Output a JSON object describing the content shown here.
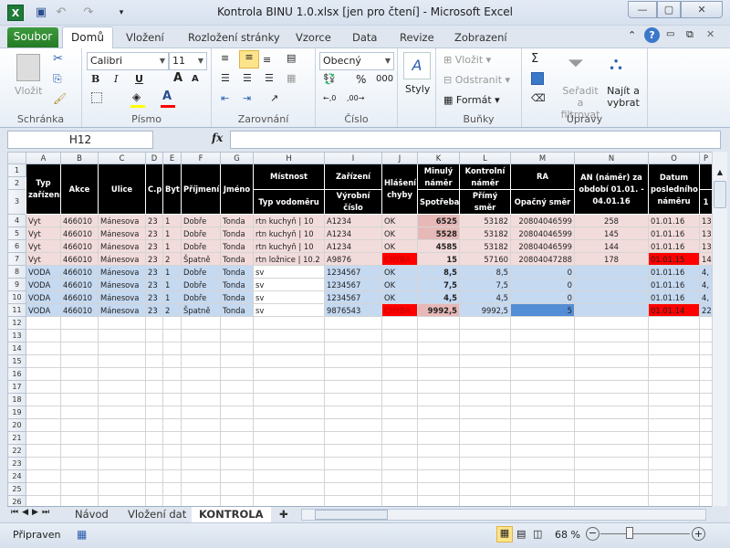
{
  "window": {
    "title": "Kontrola BINU 1.0.xlsx  [jen pro čtení]  -  Microsoft Excel"
  },
  "ribbon_tabs": {
    "file": "Soubor",
    "items": [
      "Domů",
      "Vložení",
      "Rozložení stránky",
      "Vzorce",
      "Data",
      "Revize",
      "Zobrazení"
    ]
  },
  "ribbon": {
    "clipboard": {
      "label": "Schránka",
      "paste": "Vložit"
    },
    "font": {
      "label": "Písmo",
      "name": "Calibri",
      "size": "11",
      "bold": "B",
      "italic": "I",
      "underline": "U",
      "fill_color": "#ffff00",
      "font_color": "#ff0000"
    },
    "alignment": {
      "label": "Zarovnání"
    },
    "number": {
      "label": "Číslo",
      "format": "Obecný",
      "percent": "%",
      "thousands": "000"
    },
    "styles": {
      "label": "Styly"
    },
    "cells": {
      "label": "Buňky",
      "insert": "Vložit",
      "delete": "Odstranit",
      "format": "Formát"
    },
    "editing": {
      "label": "Úpravy",
      "sort": "Seřadit a filtrovat",
      "find": "Najít a vybrat",
      "sum": "Σ"
    }
  },
  "formula_bar": {
    "name_box": "H12",
    "fx": "fx",
    "value": ""
  },
  "columns": [
    "A",
    "B",
    "C",
    "D",
    "E",
    "F",
    "G",
    "H",
    "I",
    "J",
    "K",
    "L",
    "M",
    "N",
    "O",
    "P"
  ],
  "headers": {
    "A": "Typ zařízení",
    "B": "Akce",
    "C": "Ulice",
    "D": "C.p",
    "E": "Byt",
    "F": "Příjmení",
    "G": "Jméno",
    "H_top": "Místnost",
    "H_sub": "Typ vodoměru",
    "I_top": "Zařízení",
    "I_sub": "Výrobní číslo",
    "J": "Hlášení chyby",
    "K_top": "Minulý náměr",
    "K_sub": "Spotřeba",
    "L_top": "Kontrolní náměr",
    "L_sub": "Přímý směr",
    "M_top": "RA",
    "M_sub": "Opačný směr",
    "N": "AN (náměr) za období 01.01. - 04.01.16",
    "O": "Datum posledního náměru",
    "P_sub": "1"
  },
  "rows": [
    {
      "n": 4,
      "type": "pink",
      "cells": [
        "Vyt",
        "466010",
        "Mánesova",
        "23",
        "1",
        "Dobře",
        "Tonda",
        "rtn kuchyň | 10",
        "A1234",
        "OK",
        "6525",
        "53182",
        "20804046599",
        "258",
        "01.01.16",
        "13"
      ]
    },
    {
      "n": 5,
      "type": "pink",
      "cells": [
        "Vyt",
        "466010",
        "Mánesova",
        "23",
        "1",
        "Dobře",
        "Tonda",
        "rtn kuchyň | 10",
        "A1234",
        "OK",
        "5528",
        "53182",
        "20804046599",
        "145",
        "01.01.16",
        "13"
      ]
    },
    {
      "n": 6,
      "type": "pink",
      "cells": [
        "Vyt",
        "466010",
        "Mánesova",
        "23",
        "1",
        "Dobře",
        "Tonda",
        "rtn kuchyň | 10",
        "A1234",
        "OK",
        "4585",
        "53182",
        "20804046599",
        "144",
        "01.01.16",
        "13"
      ]
    },
    {
      "n": 7,
      "type": "pink",
      "cells": [
        "Vyt",
        "466010",
        "Mánesova",
        "23",
        "2",
        "Špatně",
        "Tonda",
        "rtn ložnice | 10.2",
        "A9876",
        "CHYBA",
        "15",
        "57160",
        "20804047288",
        "178",
        "01.01.15",
        "14"
      ]
    },
    {
      "n": 8,
      "type": "blue",
      "cells": [
        "VODA",
        "466010",
        "Mánesova",
        "23",
        "1",
        "Dobře",
        "Tonda",
        "sv",
        "1234567",
        "OK",
        "8,5",
        "8,5",
        "0",
        "",
        "01.01.16",
        "4,"
      ]
    },
    {
      "n": 9,
      "type": "blue",
      "cells": [
        "VODA",
        "466010",
        "Mánesova",
        "23",
        "1",
        "Dobře",
        "Tonda",
        "sv",
        "1234567",
        "OK",
        "7,5",
        "7,5",
        "0",
        "",
        "01.01.16",
        "4,"
      ]
    },
    {
      "n": 10,
      "type": "blue",
      "cells": [
        "VODA",
        "466010",
        "Mánesova",
        "23",
        "1",
        "Dobře",
        "Tonda",
        "sv",
        "1234567",
        "OK",
        "4,5",
        "4,5",
        "0",
        "",
        "01.01.16",
        "4,"
      ]
    },
    {
      "n": 11,
      "type": "blue",
      "cells": [
        "VODA",
        "466010",
        "Mánesova",
        "23",
        "2",
        "Špatně",
        "Tonda",
        "sv",
        "9876543",
        "CHYBA",
        "9992,5",
        "9992,5",
        "5",
        "",
        "01.01.14",
        "22"
      ]
    }
  ],
  "row_colors": {
    "pink": "#f2dcdb",
    "blue": "#c5d9f1",
    "error": "#ff0000",
    "highlight": "#e6b8b7",
    "selected_blue": "#538dd5"
  },
  "highlights": [
    {
      "row": 4,
      "col": 10,
      "color": "#e6b8b7"
    },
    {
      "row": 5,
      "col": 10,
      "color": "#e6b8b7"
    },
    {
      "row": 11,
      "col": 10,
      "color": "#e6b8b7"
    },
    {
      "row": 7,
      "col": 9,
      "color": "#ff0000"
    },
    {
      "row": 11,
      "col": 9,
      "color": "#ff0000"
    },
    {
      "row": 7,
      "col": 14,
      "color": "#ff0000"
    },
    {
      "row": 11,
      "col": 14,
      "color": "#ff0000"
    },
    {
      "row": 11,
      "col": 12,
      "color": "#538dd5"
    },
    {
      "row": 8,
      "col": 7,
      "color": "#ffffff"
    },
    {
      "row": 9,
      "col": 7,
      "color": "#ffffff"
    },
    {
      "row": 10,
      "col": 7,
      "color": "#ffffff"
    },
    {
      "row": 11,
      "col": 7,
      "color": "#ffffff"
    }
  ],
  "empty_rows": [
    12,
    13,
    14,
    15,
    16,
    17,
    18,
    19,
    20,
    21,
    22,
    23,
    24,
    25,
    26,
    27
  ],
  "sheets": {
    "tabs": [
      "Návod",
      "Vložení dat",
      "KONTROLA"
    ],
    "active": "KONTROLA"
  },
  "status": {
    "ready": "Připraven",
    "zoom": "68 %",
    "zoom_percent": 68
  }
}
